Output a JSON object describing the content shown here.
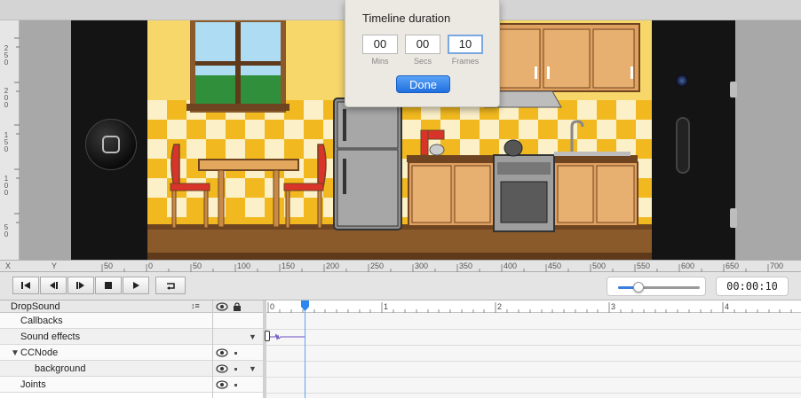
{
  "popup": {
    "title": "Timeline duration",
    "fields": [
      {
        "value": "00",
        "label": "Mins"
      },
      {
        "value": "00",
        "label": "Secs"
      },
      {
        "value": "10",
        "label": "Frames"
      }
    ],
    "done_label": "Done"
  },
  "rulers": {
    "horizontal": {
      "axis_x": "X",
      "axis_y": "Y",
      "labels": [
        "50",
        "0",
        "50",
        "100",
        "150",
        "200",
        "250",
        "300",
        "350",
        "400",
        "450",
        "500",
        "550",
        "600",
        "650",
        "700"
      ]
    },
    "vertical": {
      "labels": [
        "250",
        "200",
        "150",
        "100",
        "50"
      ]
    }
  },
  "transport": {
    "buttons": [
      {
        "name": "skip-to-start",
        "icon": "skip-start-icon"
      },
      {
        "name": "step-back",
        "icon": "step-back-icon"
      },
      {
        "name": "step-forward",
        "icon": "step-forward-icon"
      },
      {
        "name": "stop",
        "icon": "stop-icon"
      },
      {
        "name": "play",
        "icon": "play-icon"
      },
      {
        "name": "loop",
        "icon": "loop-icon"
      }
    ],
    "zoom_level": 0.25,
    "time": "00:00:10"
  },
  "timeline": {
    "sequence_name": "DropSound",
    "sort_glyph": "↕≡",
    "ruler_ticks": [
      "0",
      "1",
      "2",
      "3",
      "4"
    ],
    "rows": [
      {
        "label": "Callbacks",
        "indent": 1,
        "eye": false,
        "dot": false,
        "tri": false
      },
      {
        "label": "Sound effects",
        "indent": 1,
        "eye": false,
        "dot": false,
        "tri": true
      },
      {
        "label": "CCNode",
        "indent": 0,
        "eye": true,
        "dot": true,
        "tri": false,
        "expanded": true
      },
      {
        "label": "background",
        "indent": 2,
        "eye": true,
        "dot": true,
        "tri": true
      },
      {
        "label": "Joints",
        "indent": 1,
        "eye": true,
        "dot": true,
        "tri": false
      }
    ],
    "playhead_frame": 10
  },
  "colors": {
    "accent": "#1f6fe0",
    "playhead": "#5aa0f5",
    "wall": "#f7d66a",
    "floor": "#8a5a2b",
    "cabinet": "#e0a060"
  }
}
